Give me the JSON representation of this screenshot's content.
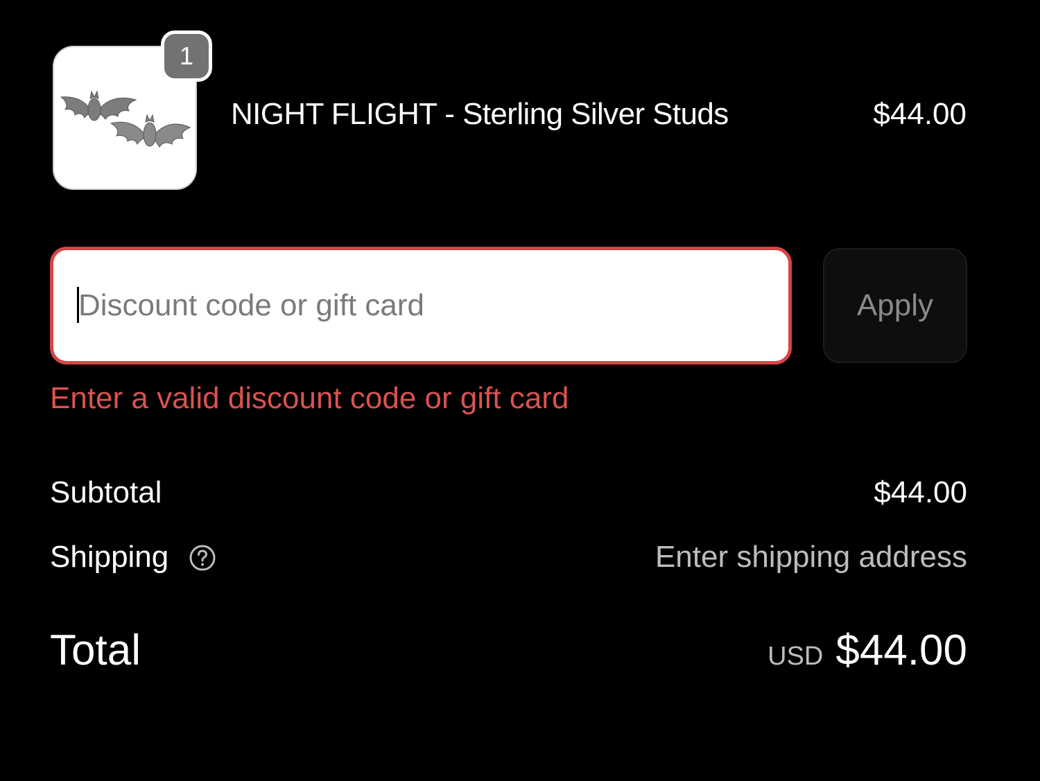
{
  "line_item": {
    "quantity": "1",
    "name": "NIGHT FLIGHT - Sterling Silver Studs",
    "price": "$44.00",
    "thumbnail_icon": "bat-earrings-image"
  },
  "discount": {
    "placeholder": "Discount code or gift card",
    "value": "",
    "apply_label": "Apply",
    "error": "Enter a valid discount code or gift card"
  },
  "summary": {
    "subtotal_label": "Subtotal",
    "subtotal_value": "$44.00",
    "shipping_label": "Shipping",
    "shipping_help_icon": "question-circle-icon",
    "shipping_value": "Enter shipping address",
    "total_label": "Total",
    "currency": "USD",
    "total_value": "$44.00"
  },
  "colors": {
    "background": "#000000",
    "error": "#d9534f",
    "field_border_error": "#d64646",
    "apply_bg": "#0e0e0e",
    "muted_text": "#bdbdbd"
  }
}
